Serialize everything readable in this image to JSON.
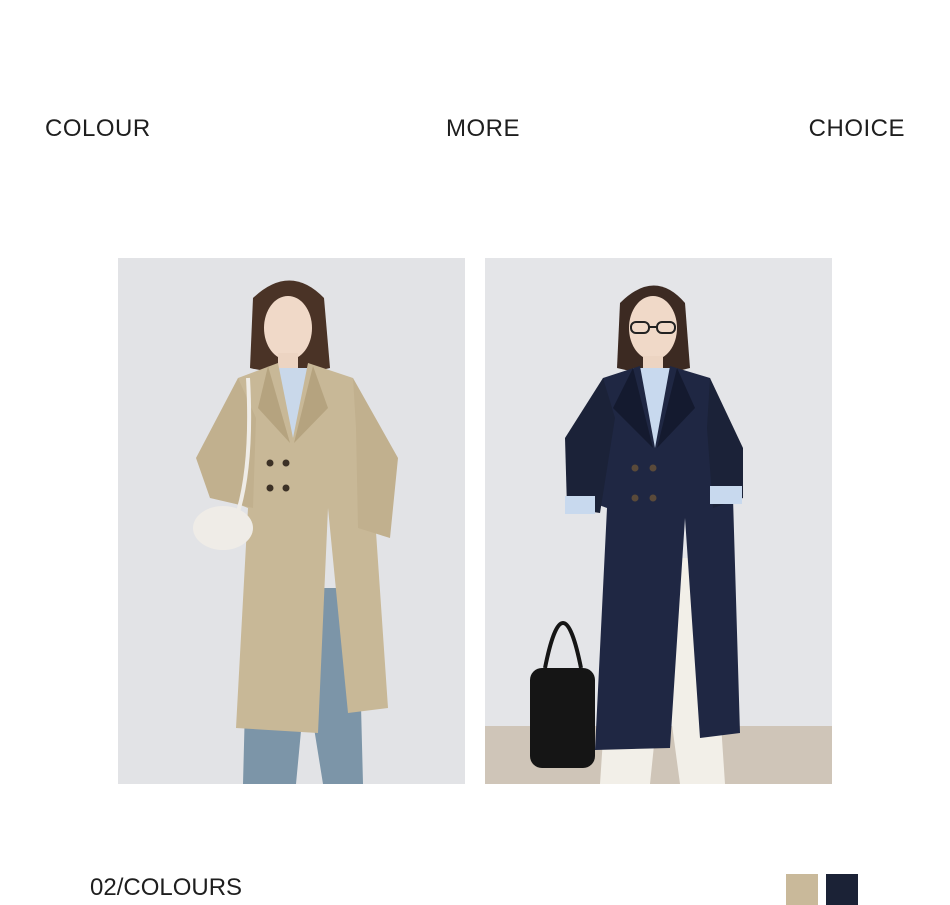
{
  "header": {
    "word_left": "COLOUR",
    "word_center": "MORE",
    "word_right": "CHOICE"
  },
  "photos": [
    {
      "name": "beige trench coat model photo",
      "coat_color": "#c8b897"
    },
    {
      "name": "navy trench coat model photo",
      "coat_color": "#1f2743"
    }
  ],
  "footer": {
    "colour_count_label": "02/COLOURS",
    "swatches": [
      {
        "color": "#c9b99a"
      },
      {
        "color": "#1b2236"
      }
    ]
  }
}
